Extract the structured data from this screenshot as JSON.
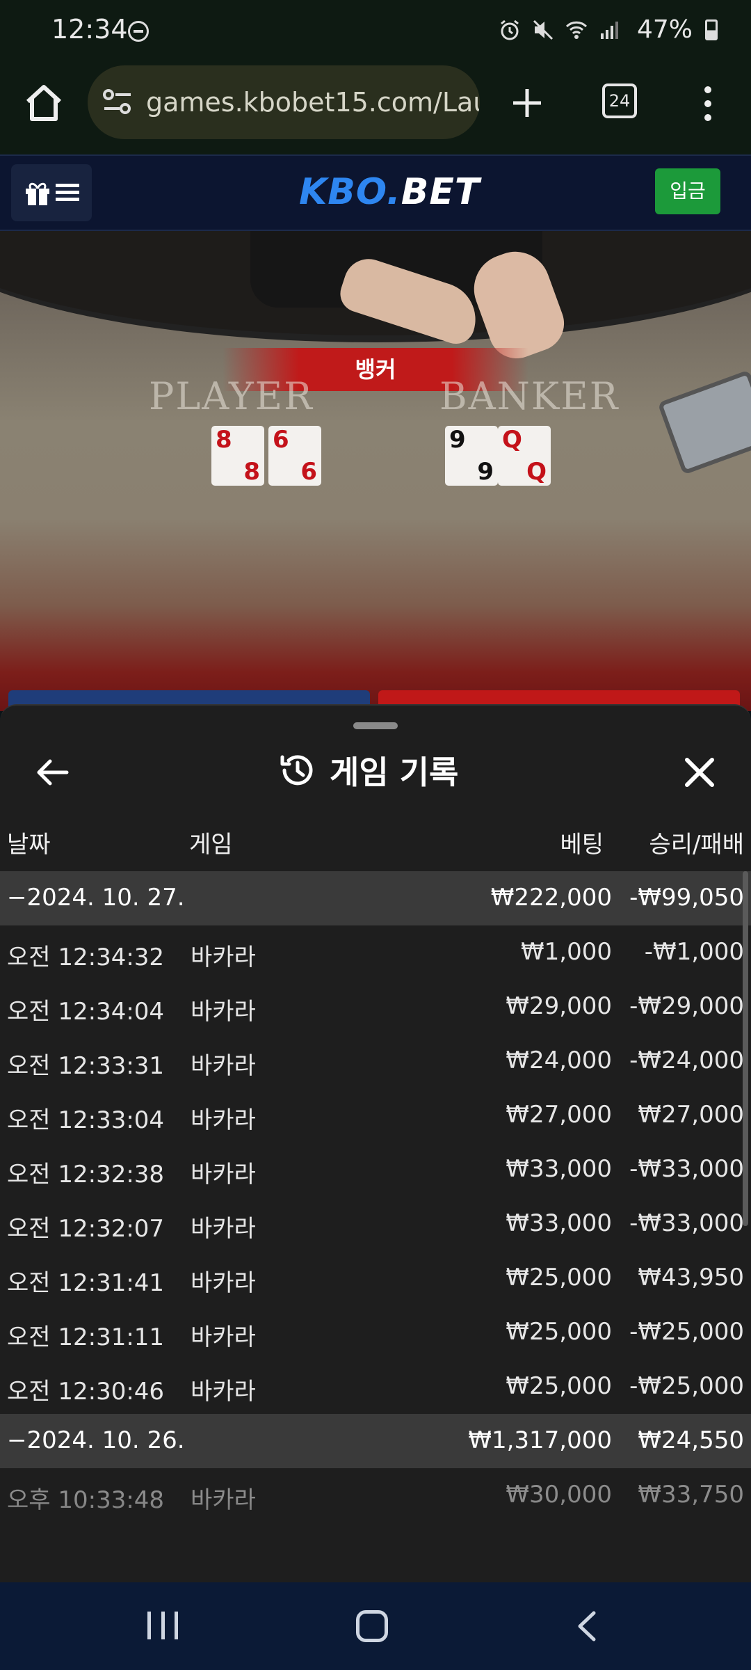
{
  "status_bar": {
    "time": "12:34",
    "battery": "47%",
    "icons": [
      "dnd-icon",
      "alarm-icon",
      "mute-icon",
      "wifi-icon",
      "signal-icon",
      "battery-charging-icon"
    ]
  },
  "browser": {
    "url": "games.kbobet15.com/Laun",
    "tab_count": "24",
    "icons": [
      "home-icon",
      "site-settings-icon",
      "plus-icon",
      "tabs-icon",
      "more-vert-icon"
    ]
  },
  "site_header": {
    "logo_part1": "KBO.",
    "logo_part2": "BET",
    "deposit_label": "입금",
    "menu_icons": [
      "gift-icon",
      "hamburger-icon"
    ]
  },
  "game_video": {
    "result_banner": "뱅커",
    "player_label": "PLAYER",
    "banker_label": "BANKER",
    "player_cards": [
      {
        "rank": "8",
        "color": "red"
      },
      {
        "rank": "6",
        "color": "red"
      }
    ],
    "banker_cards": [
      {
        "rank": "9",
        "color": "black"
      },
      {
        "rank": "Q",
        "color": "red"
      }
    ]
  },
  "history_sheet": {
    "title": "게임 기록",
    "columns": {
      "date": "날짜",
      "game": "게임",
      "bet": "베팅",
      "result": "승리/패배"
    },
    "rows": [
      {
        "type": "group",
        "date": "−2024. 10. 27.",
        "game": "",
        "bet": "₩222,000",
        "result": "-₩99,050"
      },
      {
        "type": "item",
        "date": "오전 12:34:32",
        "game": "바카라",
        "bet": "₩1,000",
        "result": "-₩1,000"
      },
      {
        "type": "item",
        "date": "오전 12:34:04",
        "game": "바카라",
        "bet": "₩29,000",
        "result": "-₩29,000"
      },
      {
        "type": "item",
        "date": "오전 12:33:31",
        "game": "바카라",
        "bet": "₩24,000",
        "result": "-₩24,000"
      },
      {
        "type": "item",
        "date": "오전 12:33:04",
        "game": "바카라",
        "bet": "₩27,000",
        "result": "₩27,000"
      },
      {
        "type": "item",
        "date": "오전 12:32:38",
        "game": "바카라",
        "bet": "₩33,000",
        "result": "-₩33,000"
      },
      {
        "type": "item",
        "date": "오전 12:32:07",
        "game": "바카라",
        "bet": "₩33,000",
        "result": "-₩33,000"
      },
      {
        "type": "item",
        "date": "오전 12:31:41",
        "game": "바카라",
        "bet": "₩25,000",
        "result": "₩43,950"
      },
      {
        "type": "item",
        "date": "오전 12:31:11",
        "game": "바카라",
        "bet": "₩25,000",
        "result": "-₩25,000"
      },
      {
        "type": "item",
        "date": "오전 12:30:46",
        "game": "바카라",
        "bet": "₩25,000",
        "result": "-₩25,000"
      },
      {
        "type": "group",
        "date": "−2024. 10. 26.",
        "game": "",
        "bet": "₩1,317,000",
        "result": "₩24,550"
      },
      {
        "type": "item",
        "date": "오후 10:33:48",
        "game": "바카라",
        "bet": "₩30,000",
        "result": "₩33,750"
      }
    ]
  },
  "colors": {
    "deposit_green": "#1c9a3a",
    "logo_blue": "#2e86f0",
    "banner_red": "#c01a1a",
    "sheet_bg": "#1e1e1e",
    "group_row_bg": "#3a3a3a"
  }
}
